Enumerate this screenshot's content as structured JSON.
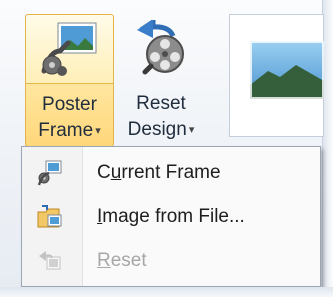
{
  "ribbon": {
    "poster_frame": {
      "line1": "Poster",
      "line2": "Frame"
    },
    "reset_design": {
      "line1": "Reset",
      "line2": "Design"
    }
  },
  "menu": {
    "items": [
      {
        "label": "Current Frame",
        "accel": "u",
        "icon": "movie-frame-icon",
        "enabled": true
      },
      {
        "label": "Image from File...",
        "accel": "I",
        "icon": "folder-image-icon",
        "enabled": true
      },
      {
        "label": "Reset",
        "accel": "R",
        "icon": "reset-arrow-icon",
        "enabled": false
      }
    ]
  },
  "colors": {
    "highlight_border": "#e3b44a",
    "highlight_fill": "#ffe9a6",
    "disabled_text": "#a7a7a7"
  }
}
